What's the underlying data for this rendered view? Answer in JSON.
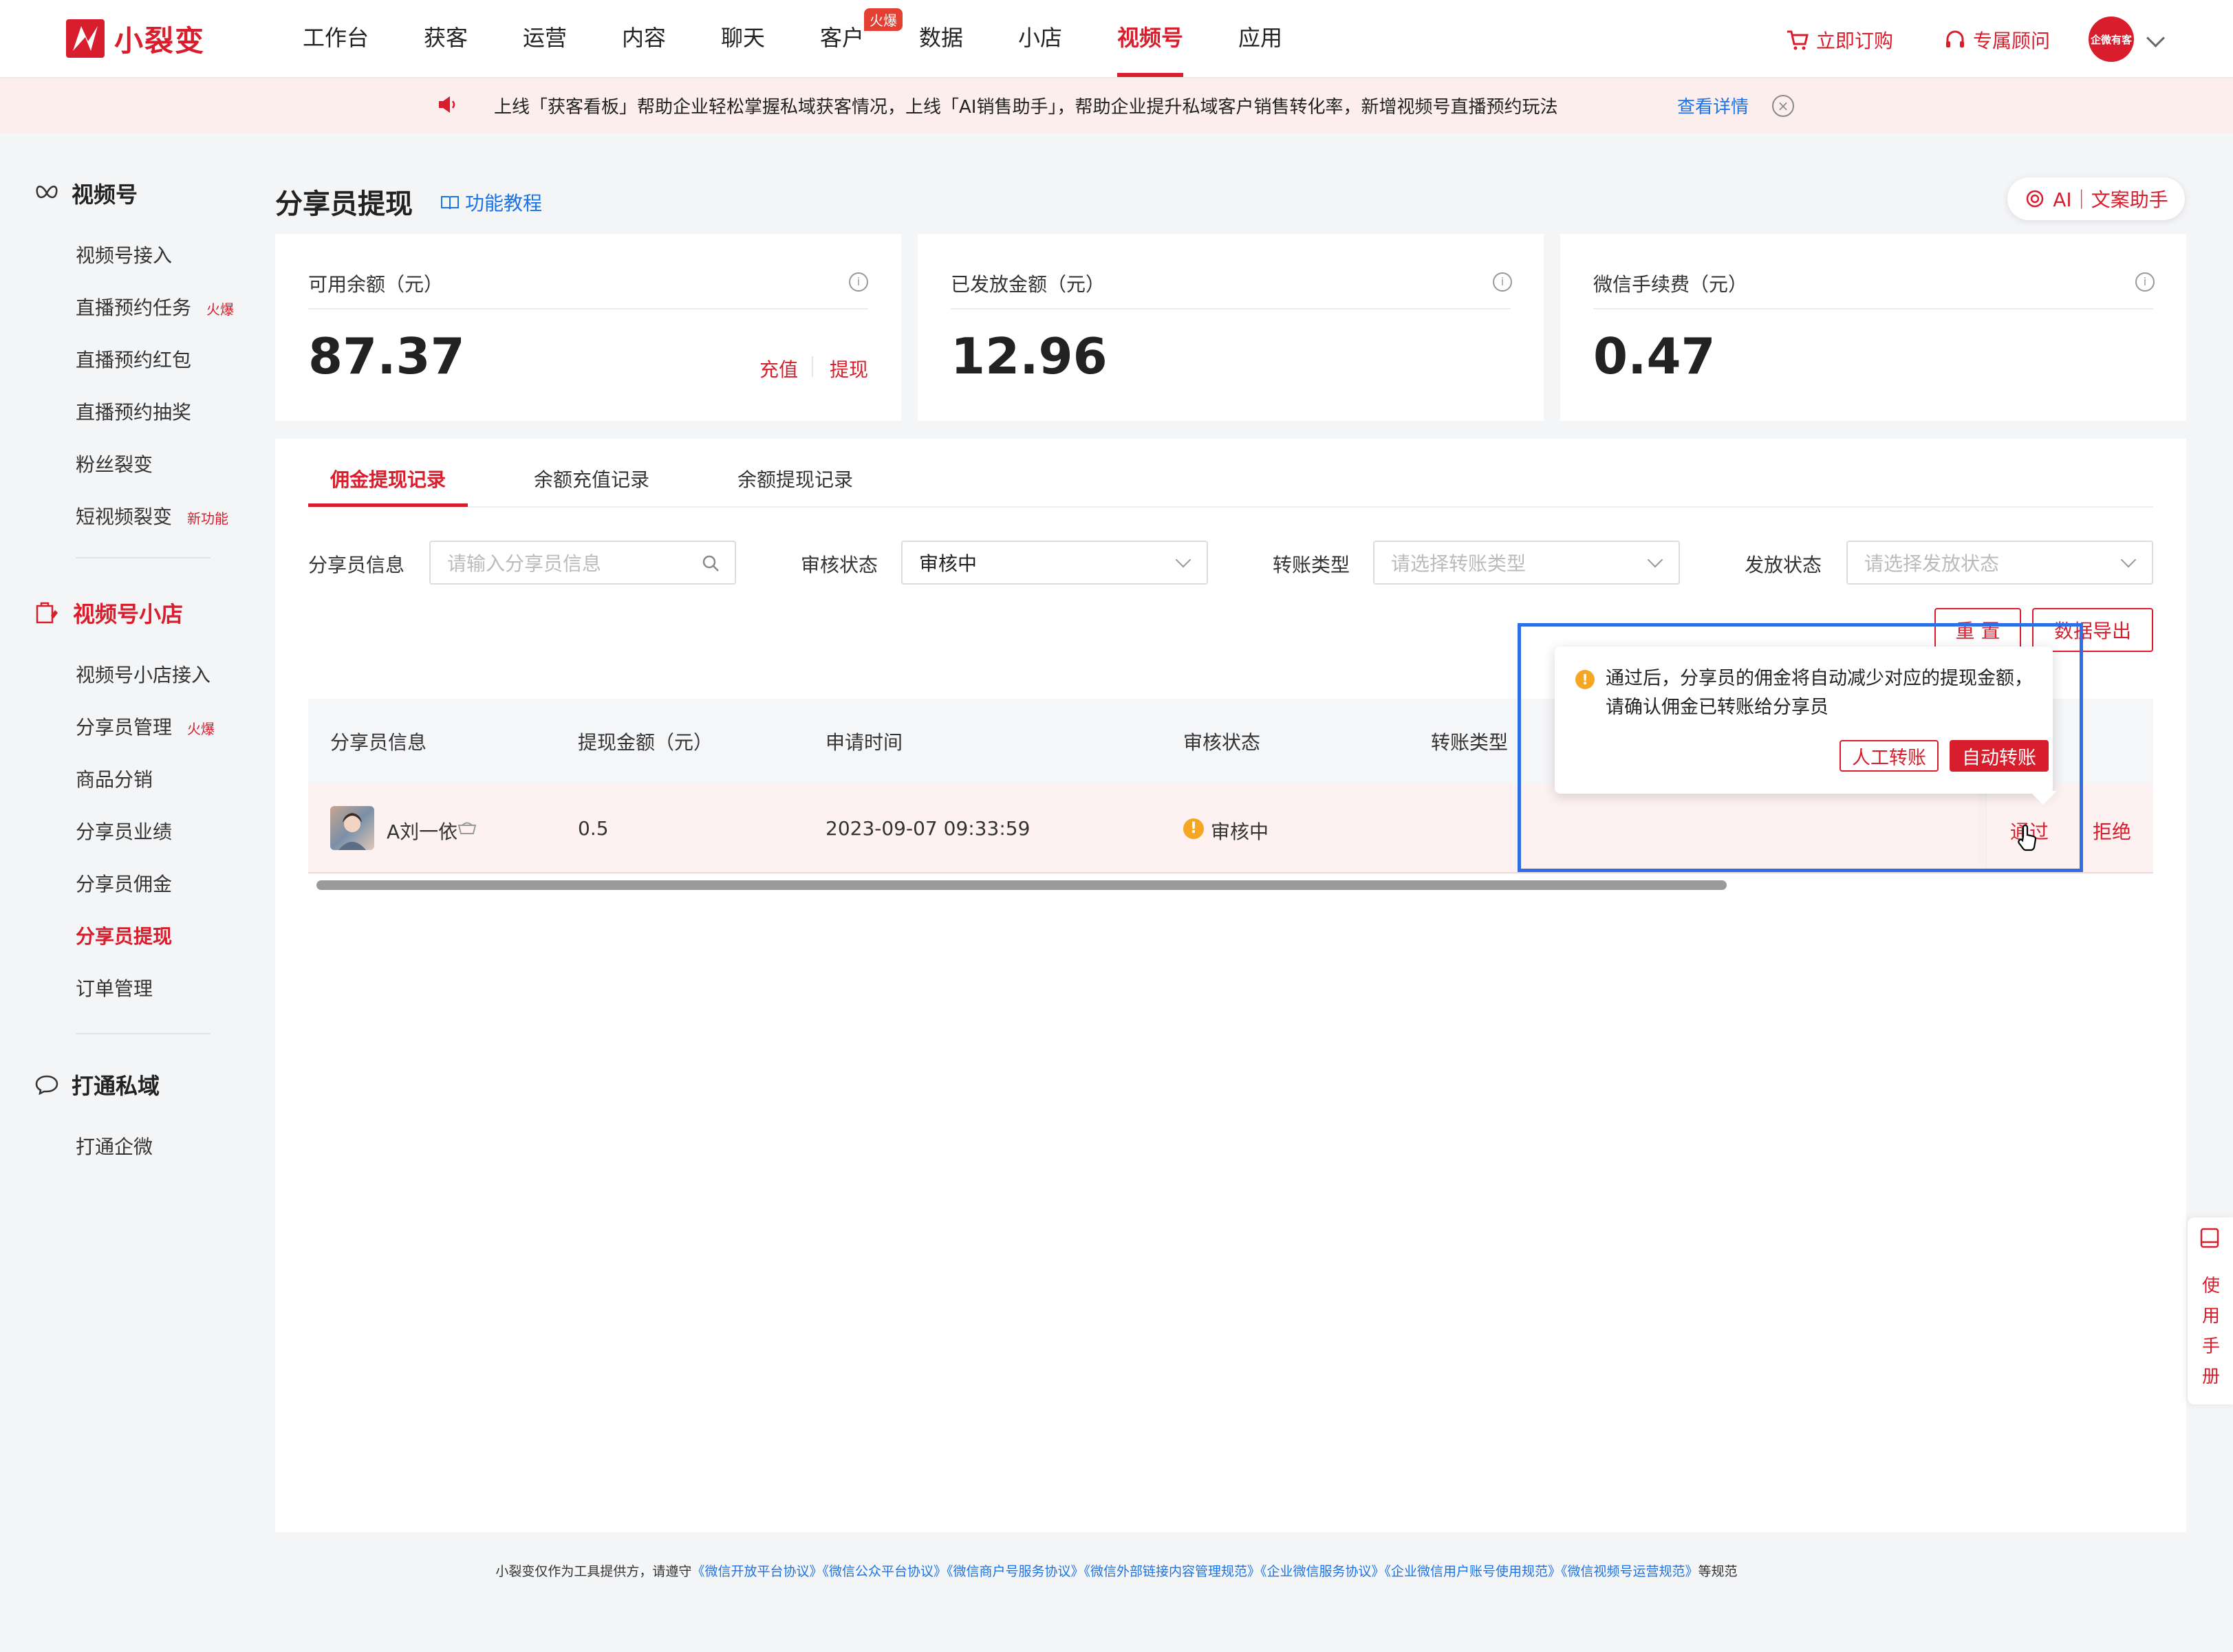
{
  "brand": {
    "name": "小裂变",
    "color": "#d81e2c"
  },
  "nav": {
    "items": [
      "工作台",
      "获客",
      "运营",
      "内容",
      "聊天",
      "客户",
      "数据",
      "小店",
      "视频号",
      "应用"
    ],
    "active": "视频号",
    "hot_badge": "火爆",
    "subscribe": "立即订购",
    "consultant": "专属顾问",
    "org_avatar": "企微有客"
  },
  "banner": {
    "text": "上线「获客看板」帮助企业轻松掌握私域获客情况，上线「AI销售助手」，帮助企业提升私域客户销售转化率，新增视频号直播预约玩法",
    "link": "查看详情"
  },
  "sidebar": {
    "sections": [
      {
        "title": "视频号",
        "items": [
          {
            "label": "视频号接入",
            "tag": ""
          },
          {
            "label": "直播预约任务",
            "tag": "火爆"
          },
          {
            "label": "直播预约红包",
            "tag": ""
          },
          {
            "label": "直播预约抽奖",
            "tag": ""
          },
          {
            "label": "粉丝裂变",
            "tag": ""
          },
          {
            "label": "短视频裂变",
            "tag": "新功能"
          }
        ]
      },
      {
        "title": "视频号小店",
        "items": [
          {
            "label": "视频号小店接入",
            "tag": ""
          },
          {
            "label": "分享员管理",
            "tag": "火爆"
          },
          {
            "label": "商品分销",
            "tag": ""
          },
          {
            "label": "分享员业绩",
            "tag": ""
          },
          {
            "label": "分享员佣金",
            "tag": ""
          },
          {
            "label": "分享员提现",
            "tag": ""
          },
          {
            "label": "订单管理",
            "tag": ""
          }
        ]
      },
      {
        "title": "打通私域",
        "items": [
          {
            "label": "打通企微",
            "tag": ""
          }
        ]
      }
    ],
    "active": "分享员提现"
  },
  "page": {
    "title": "分享员提现",
    "tutorial": "功能教程",
    "ai_assistant": "AI｜文案助手"
  },
  "cards": [
    {
      "label": "可用余额（元）",
      "value": "87.37",
      "actions": [
        "充值",
        "提现"
      ]
    },
    {
      "label": "已发放金额（元）",
      "value": "12.96",
      "actions": []
    },
    {
      "label": "微信手续费（元）",
      "value": "0.47",
      "actions": []
    }
  ],
  "tabs": [
    "佣金提现记录",
    "余额充值记录",
    "余额提现记录"
  ],
  "active_tab": "佣金提现记录",
  "filters": {
    "sharer_label": "分享员信息",
    "sharer_placeholder": "请输入分享员信息",
    "review_label": "审核状态",
    "review_value": "审核中",
    "transfer_label": "转账类型",
    "transfer_placeholder": "请选择转账类型",
    "issue_label": "发放状态",
    "issue_placeholder": "请选择发放状态",
    "reset": "重 置",
    "export": "数据导出"
  },
  "table": {
    "headers": [
      "分享员信息",
      "提现金额（元）",
      "申请时间",
      "审核状态",
      "转账类型"
    ],
    "rows": [
      {
        "name": "A刘一依",
        "amount": "0.5",
        "time": "2023-09-07 09:33:59",
        "status": "审核中",
        "approve": "通过",
        "reject": "拒绝"
      }
    ]
  },
  "popover": {
    "message": "通过后，分享员的佣金将自动减少对应的提现金额，请确认佣金已转账给分享员",
    "manual": "人工转账",
    "auto": "自动转账"
  },
  "manual_side": "使用手册",
  "footer": {
    "prefix": "小裂变仅作为工具提供方，请遵守",
    "links": [
      "《微信开放平台协议》",
      "《微信公众平台协议》",
      "《微信商户号服务协议》",
      "《微信外部链接内容管理规范》",
      "《企业微信服务协议》",
      "《企业微信用户账号使用规范》",
      "《微信视频号运营规范》"
    ],
    "suffix": "等规范"
  }
}
